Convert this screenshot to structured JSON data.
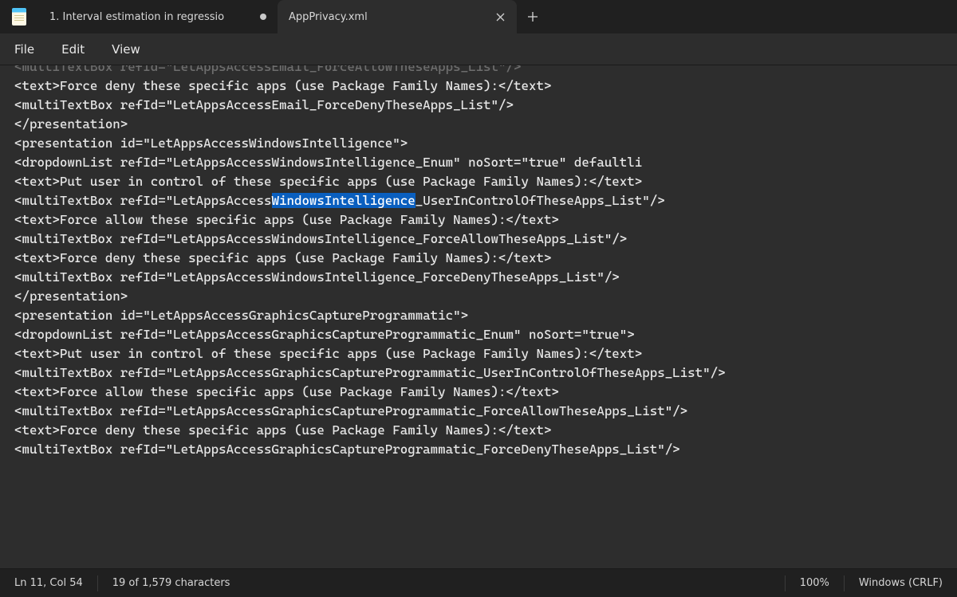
{
  "tabs": {
    "inactive": {
      "title": "1. Interval estimation in regressio"
    },
    "active": {
      "title": "AppPrivacy.xml"
    }
  },
  "menu": {
    "file": "File",
    "edit": "Edit",
    "view": "View"
  },
  "editor": {
    "sel": "WindowsIntelligence",
    "l00": "<multiTextBox refId=\"LetAppsAccessEmail_ForceAllowTheseApps_List\"/>",
    "l01": "<text>Force deny these specific apps (use Package Family Names):</text>",
    "l02": "<multiTextBox refId=\"LetAppsAccessEmail_ForceDenyTheseApps_List\"/>",
    "l03": "",
    "l04": "</presentation>",
    "l05": "",
    "l06": "<presentation id=\"LetAppsAccessWindowsIntelligence\">",
    "l07": "<dropdownList refId=\"LetAppsAccessWindowsIntelligence_Enum\" noSort=\"true\" defaultli",
    "l08": "<text>Put user in control of these specific apps (use Package Family Names):</text>",
    "l09a": "<multiTextBox refId=\"LetAppsAccess",
    "l09b": "_UserInControlOfTheseApps_List\"/>",
    "l10": "<text>Force allow these specific apps (use Package Family Names):</text>",
    "l11": "<multiTextBox refId=\"LetAppsAccessWindowsIntelligence_ForceAllowTheseApps_List\"/>",
    "l12": "<text>Force deny these specific apps (use Package Family Names):</text>",
    "l13": "<multiTextBox refId=\"LetAppsAccessWindowsIntelligence_ForceDenyTheseApps_List\"/>",
    "l14": "",
    "l15": "</presentation>",
    "l16": "",
    "l17": "<presentation id=\"LetAppsAccessGraphicsCaptureProgrammatic\">",
    "l18": "<dropdownList refId=\"LetAppsAccessGraphicsCaptureProgrammatic_Enum\" noSort=\"true\">",
    "l19": "<text>Put user in control of these specific apps (use Package Family Names):</text>",
    "l20": "<multiTextBox refId=\"LetAppsAccessGraphicsCaptureProgrammatic_UserInControlOfTheseApps_List\"/>",
    "l21": "<text>Force allow these specific apps (use Package Family Names):</text>",
    "l22": "<multiTextBox refId=\"LetAppsAccessGraphicsCaptureProgrammatic_ForceAllowTheseApps_List\"/>",
    "l23": "<text>Force deny these specific apps (use Package Family Names):</text>",
    "l24": "<multiTextBox refId=\"LetAppsAccessGraphicsCaptureProgrammatic_ForceDenyTheseApps_List\"/>"
  },
  "status": {
    "pos": "Ln 11, Col 54",
    "sel": "19 of 1,579 characters",
    "zoom": "100%",
    "eol": "Windows (CRLF)"
  }
}
